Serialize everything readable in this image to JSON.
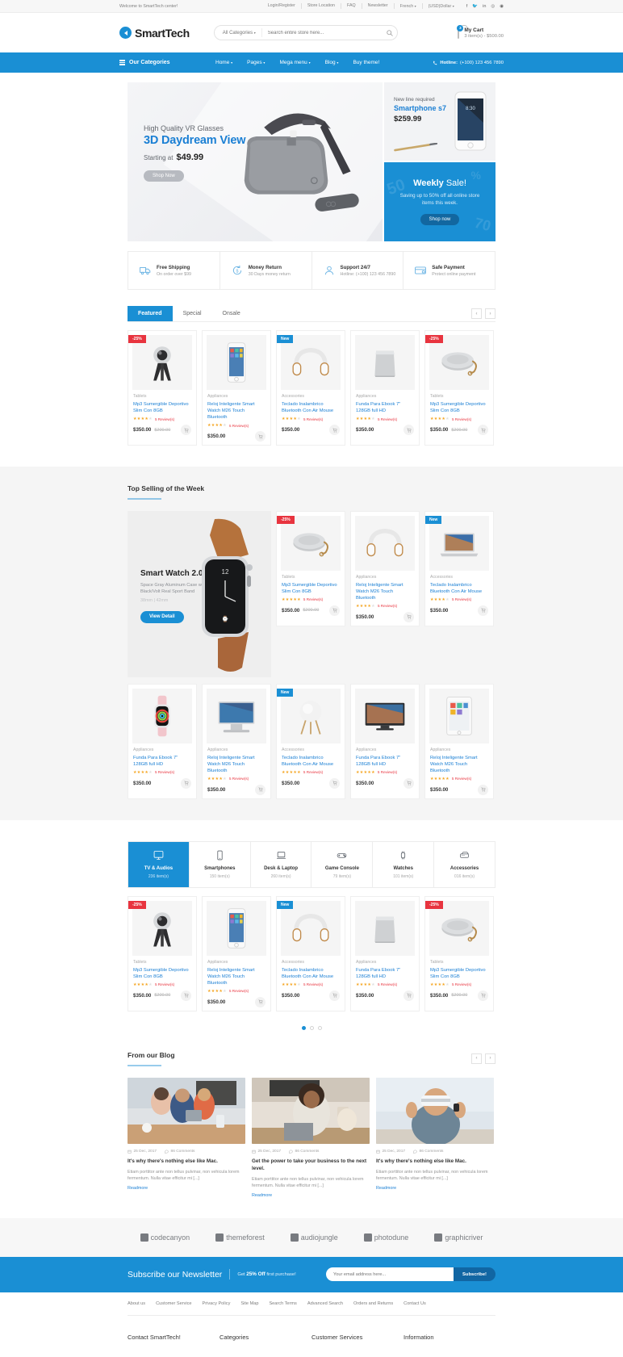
{
  "topbar": {
    "welcome": "Welcome to SmartTech center!",
    "links": [
      "Login/Register",
      "Store Location",
      "FAQ",
      "Newsletter"
    ],
    "language": "French",
    "currency": "(USD)Dollar",
    "socials": [
      "facebook-icon",
      "twitter-icon",
      "linkedin-icon",
      "pinterest-icon",
      "google-icon"
    ]
  },
  "header": {
    "brand": "SmartTech",
    "category_select": "All Categories",
    "search_placeholder": "Search entire store here...",
    "cart_title": "My Cart",
    "cart_summary": "3 item(s) - $500.00",
    "cart_count": "3"
  },
  "nav": {
    "categories_label": "Our Categories",
    "menu": [
      "Home",
      "Pages",
      "Mega menu",
      "Blog",
      "Buy theme!"
    ],
    "hotline_label": "Hotline:",
    "hotline_value": "(+100) 123 456 7890"
  },
  "hero": {
    "eyebrow": "High Quality VR Glasses",
    "title": "3D Daydream View",
    "price_label": "Starting at",
    "price": "$49.99",
    "cta": "Shop Now"
  },
  "promo_top": {
    "eyebrow": "New line required",
    "title": "Smartphone s7",
    "price": "$259.99"
  },
  "promo_bottom": {
    "title_bold": "Weekly",
    "title_thin": "Sale!",
    "text": "Saving up to 50% off all online store items this week.",
    "cta": "Shop now"
  },
  "services": [
    {
      "icon": "truck-icon",
      "title": "Free Shipping",
      "sub": "On order over $99"
    },
    {
      "icon": "refresh-icon",
      "title": "Money Return",
      "sub": "30 Days money return"
    },
    {
      "icon": "headset-icon",
      "title": "Support 24/7",
      "sub": "Hotline: (+100) 123 456 7890"
    },
    {
      "icon": "card-icon",
      "title": "Safe Payment",
      "sub": "Protect online payment"
    }
  ],
  "featured": {
    "tabs": [
      "Featured",
      "Special",
      "Onsale"
    ],
    "active_tab": "Featured",
    "prev": "‹",
    "next": "›",
    "products": [
      {
        "badge": "-25%",
        "badge_type": "sale",
        "image": "camera-tripod-icon",
        "category": "Tablets",
        "name": "Mp3 Sumergible Deportivo Slim Con 8GB",
        "stars": 4,
        "reviews": "5 Review(s)",
        "price": "$350.00",
        "old_price": "$200.00"
      },
      {
        "badge": "",
        "badge_type": "",
        "image": "smartphone-icon",
        "category": "Appliances",
        "name": "Reloj Inteligente Smart Watch M26 Touch Bluetooth",
        "stars": 4,
        "reviews": "5 Review(s)",
        "price": "$350.00",
        "old_price": ""
      },
      {
        "badge": "New",
        "badge_type": "new",
        "image": "headphones-icon",
        "category": "Accessories",
        "name": "Teclado Inalambrico Bluetooth Con Air Mouse",
        "stars": 4,
        "reviews": "5 Review(s)",
        "price": "$350.00",
        "old_price": ""
      },
      {
        "badge": "",
        "badge_type": "",
        "image": "speaker-box-icon",
        "category": "Appliances",
        "name": "Funda Para Ebook 7\" 128GB full HD",
        "stars": 4,
        "reviews": "5 Review(s)",
        "price": "$350.00",
        "old_price": ""
      },
      {
        "badge": "-25%",
        "badge_type": "sale",
        "image": "bluetooth-speaker-icon",
        "category": "Tablets",
        "name": "Mp3 Sumergible Deportivo Slim Con 8GB",
        "stars": 4,
        "reviews": "5 Review(s)",
        "price": "$350.00",
        "old_price": "$200.00"
      }
    ]
  },
  "top_selling": {
    "title": "Top Selling of the Week",
    "promo": {
      "title": "Smart Watch 2.0",
      "subtitle": "Space Gray Aluminum Case with Black/Volt Real Sport Band",
      "sizes": "38mm | 42mm",
      "cta": "View Detail"
    },
    "row1": [
      {
        "badge": "-25%",
        "badge_type": "sale",
        "image": "bluetooth-speaker-icon",
        "category": "Tablets",
        "name": "Mp3 Sumergible Deportivo Slim Con 8GB",
        "stars": 5,
        "reviews": "5 Review(s)",
        "price": "$350.00",
        "old_price": "$200.00"
      },
      {
        "badge": "",
        "badge_type": "",
        "image": "headphones-icon",
        "category": "Appliances",
        "name": "Reloj Inteligente Smart Watch M26 Touch Bluetooth",
        "stars": 4,
        "reviews": "5 Review(s)",
        "price": "$350.00",
        "old_price": ""
      },
      {
        "badge": "New",
        "badge_type": "new",
        "image": "laptop-icon",
        "category": "Accessories",
        "name": "Teclado Inalambrico Bluetooth Con Air Mouse",
        "stars": 4,
        "reviews": "5 Review(s)",
        "price": "$350.00",
        "old_price": ""
      }
    ],
    "row2": [
      {
        "badge": "",
        "badge_type": "",
        "image": "smartwatch-icon",
        "category": "Appliances",
        "name": "Funda Para Ebook 7\" 128GB full HD",
        "stars": 4,
        "reviews": "5 Review(s)",
        "price": "$350.00",
        "old_price": ""
      },
      {
        "badge": "",
        "badge_type": "",
        "image": "imac-icon",
        "category": "Appliances",
        "name": "Reloj Inteligente Smart Watch M26 Touch Bluetooth",
        "stars": 4,
        "reviews": "5 Review(s)",
        "price": "$350.00",
        "old_price": ""
      },
      {
        "badge": "New",
        "badge_type": "new",
        "image": "lamp-icon",
        "category": "Accessories",
        "name": "Teclado Inalambrico Bluetooth Con Air Mouse",
        "stars": 5,
        "reviews": "5 Review(s)",
        "price": "$350.00",
        "old_price": ""
      },
      {
        "badge": "",
        "badge_type": "",
        "image": "tv-icon",
        "category": "Appliances",
        "name": "Funda Para Ebook 7\" 128GB full HD",
        "stars": 5,
        "reviews": "5 Review(s)",
        "price": "$350.00",
        "old_price": ""
      },
      {
        "badge": "",
        "badge_type": "",
        "image": "tablet-icon",
        "category": "Appliances",
        "name": "Reloj Inteligente Smart Watch M26 Touch Bluetooth",
        "stars": 5,
        "reviews": "5 Review(s)",
        "price": "$350.00",
        "old_price": ""
      }
    ]
  },
  "category_tabs": [
    {
      "icon": "tv-monitor-icon",
      "label": "TV & Audios",
      "count": "236 item(s)",
      "active": true
    },
    {
      "icon": "smartphone-icon",
      "label": "Smartphones",
      "count": "150 item(s)",
      "active": false
    },
    {
      "icon": "laptop-icon",
      "label": "Desk & Laptop",
      "count": "260 item(s)",
      "active": false
    },
    {
      "icon": "gamepad-icon",
      "label": "Game Console",
      "count": "79 item(s)",
      "active": false
    },
    {
      "icon": "watch-icon",
      "label": "Watches",
      "count": "101 item(s)",
      "active": false
    },
    {
      "icon": "accessories-icon",
      "label": "Accessories",
      "count": "016 item(s)",
      "active": false
    }
  ],
  "category_products": [
    {
      "badge": "-25%",
      "badge_type": "sale",
      "image": "camera-tripod-icon",
      "category": "Tablets",
      "name": "Mp3 Sumergible Deportivo Slim Con 8GB",
      "stars": 4,
      "reviews": "5 Review(s)",
      "price": "$350.00",
      "old_price": "$200.00"
    },
    {
      "badge": "",
      "badge_type": "",
      "image": "smartphone-icon",
      "category": "Appliances",
      "name": "Reloj Inteligente Smart Watch M26 Touch Bluetooth",
      "stars": 4,
      "reviews": "5 Review(s)",
      "price": "$350.00",
      "old_price": ""
    },
    {
      "badge": "New",
      "badge_type": "new",
      "image": "headphones-icon",
      "category": "Accessories",
      "name": "Teclado Inalambrico Bluetooth Con Air Mouse",
      "stars": 4,
      "reviews": "5 Review(s)",
      "price": "$350.00",
      "old_price": ""
    },
    {
      "badge": "",
      "badge_type": "",
      "image": "speaker-box-icon",
      "category": "Appliances",
      "name": "Funda Para Ebook 7\" 128GB full HD",
      "stars": 4,
      "reviews": "5 Review(s)",
      "price": "$350.00",
      "old_price": ""
    },
    {
      "badge": "-25%",
      "badge_type": "sale",
      "image": "bluetooth-speaker-icon",
      "category": "Tablets",
      "name": "Mp3 Sumergible Deportivo Slim Con 8GB",
      "stars": 4,
      "reviews": "5 Review(s)",
      "price": "$350.00",
      "old_price": "$200.00"
    }
  ],
  "blog": {
    "title": "From our Blog",
    "prev": "‹",
    "next": "›",
    "posts": [
      {
        "image": "family-tablet-photo",
        "date": "25 Dec, 2017",
        "comments": "86 Comments",
        "title": "It's why there's nothing else like Mac.",
        "excerpt": "Etiam porttitor ante non tellus pulvinar, non vehicula lorem fermentum. Nulla vitae efficitur mi [...]",
        "more": "Readmore"
      },
      {
        "image": "woman-laptop-photo",
        "date": "25 Dec, 2017",
        "comments": "86 Comments",
        "title": "Get the power to take your business to the next level.",
        "excerpt": "Etiam porttitor ante non tellus pulvinar, non vehicula lorem fermentum. Nulla vitae efficitur mi [...]",
        "more": "Readmore"
      },
      {
        "image": "man-vr-photo",
        "date": "25 Dec, 2017",
        "comments": "86 Comments",
        "title": "It's why there's nothing else like Mac.",
        "excerpt": "Etiam porttitor ante non tellus pulvinar, non vehicula lorem fermentum. Nulla vitae efficitur mi [...]",
        "more": "Readmore"
      }
    ]
  },
  "brands": [
    "codecanyon",
    "themeforest",
    "audiojungle",
    "photodune",
    "graphicriver"
  ],
  "newsletter": {
    "title": "Subscribe our Newsletter",
    "offer_pre": "Get",
    "offer_bold": "25% Off",
    "offer_post": "first purchase!",
    "placeholder": "Your email address here...",
    "button": "Subscribe!"
  },
  "footer": {
    "links": [
      "About us",
      "Customer Service",
      "Privacy Policy",
      "Site Map",
      "Search Terms",
      "Advanced Search",
      "Orders and Returns",
      "Contact Us"
    ],
    "columns": [
      "Contact SmartTech!",
      "Categories",
      "Customer Services",
      "Information"
    ]
  },
  "colors": {
    "primary": "#1a8fd4",
    "sale": "#e8343f",
    "star": "#f5a623"
  }
}
